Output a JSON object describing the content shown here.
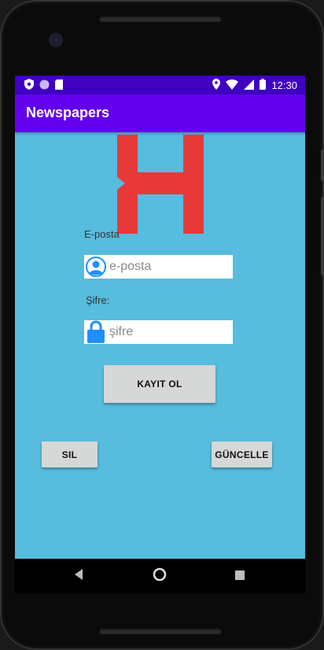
{
  "status_bar": {
    "time": "12:30",
    "left_icons": [
      "shield-icon",
      "circle-icon",
      "sd-card-icon"
    ],
    "right_icons": [
      "location-icon",
      "wifi-icon",
      "signal-icon",
      "battery-icon"
    ]
  },
  "app_bar": {
    "title": "Newspapers"
  },
  "colors": {
    "status_bar": "#3f00c1",
    "app_bar": "#6200ee",
    "background": "#57bcdd",
    "logo": "#e8393a",
    "icon_accent": "#1e90ff",
    "button": "#d6d7d7"
  },
  "form": {
    "email_label": "E-posta",
    "email_placeholder": "e-posta",
    "email_value": "",
    "password_label": "Şifre:",
    "password_placeholder": "şifre",
    "password_value": "",
    "register_button": "KAYIT OL"
  },
  "actions": {
    "delete_button": "SIL",
    "update_button": "GÜNCELLE"
  },
  "nav_bar": {
    "icons": [
      "back-icon",
      "home-icon",
      "recents-icon"
    ]
  }
}
